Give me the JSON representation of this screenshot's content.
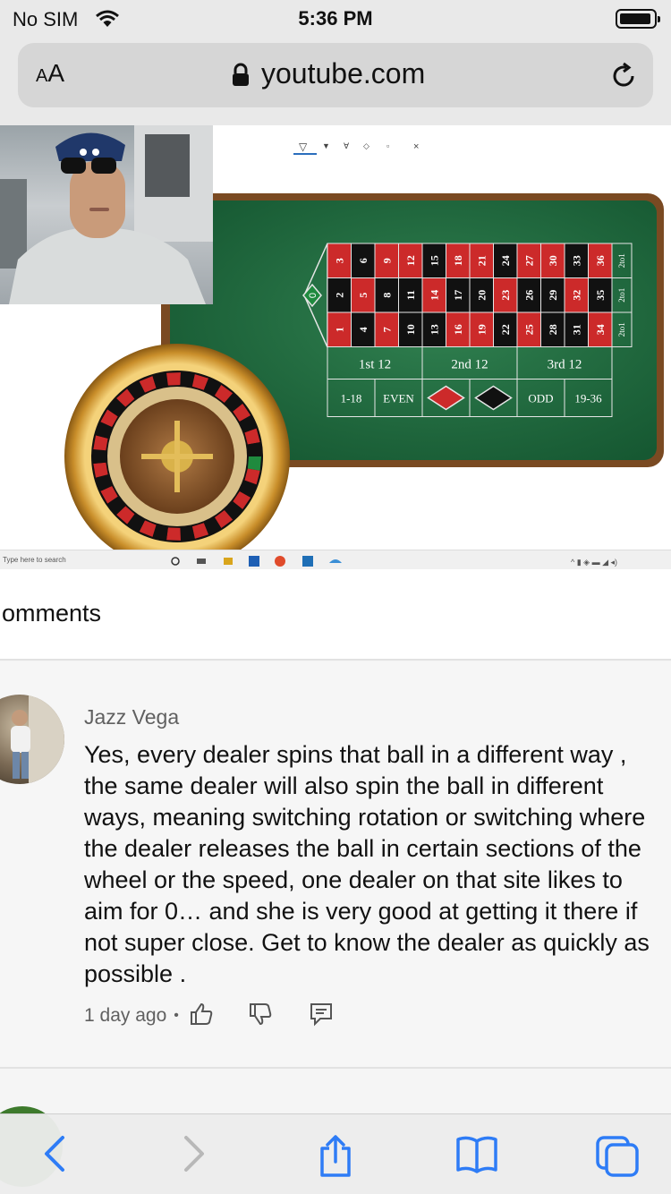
{
  "status_bar": {
    "carrier": "No SIM",
    "time": "5:36 PM"
  },
  "address_bar": {
    "text_size_small": "A",
    "text_size_large": "A",
    "domain": "youtube.com"
  },
  "video": {
    "taskbar_search_placeholder": "Type here to search",
    "roulette": {
      "zero": "0",
      "top_row": [
        "3",
        "6",
        "9",
        "12",
        "15",
        "18",
        "21",
        "24",
        "27",
        "30",
        "33",
        "36"
      ],
      "mid_row": [
        "2",
        "5",
        "8",
        "11",
        "14",
        "17",
        "20",
        "23",
        "26",
        "29",
        "32",
        "35"
      ],
      "bottom_row": [
        "1",
        "4",
        "7",
        "10",
        "13",
        "16",
        "19",
        "22",
        "25",
        "28",
        "31",
        "34"
      ],
      "column_bets": [
        "2to1",
        "2to1",
        "2to1"
      ],
      "dozens": [
        "1st 12",
        "2nd 12",
        "3rd 12"
      ],
      "outside_bets": [
        "1-18",
        "EVEN",
        "ODD",
        "19-36"
      ],
      "colors": {
        "red": "#cc2a2a",
        "black": "#111111",
        "felt": "#1f6b3f",
        "rail": "#7a4a22"
      }
    }
  },
  "comments": {
    "header": "omments",
    "items": [
      {
        "author": "Jazz Vega",
        "text": "Yes, every dealer spins that ball in a different way , the same dealer will also spin the ball in different ways, meaning switching rotation or switching where the dealer releases the ball in certain sections of the wheel or the speed, one dealer on that site likes to aim for 0… and she is very good at getting it there if not super close. Get to know the dealer as quickly as possible .",
        "time": "1 day ago",
        "separator": "•"
      }
    ]
  },
  "toolbar": {
    "icons": [
      "back-icon",
      "forward-icon",
      "share-icon",
      "bookmarks-icon",
      "tabs-icon"
    ],
    "accent": "#2e7cf6"
  }
}
